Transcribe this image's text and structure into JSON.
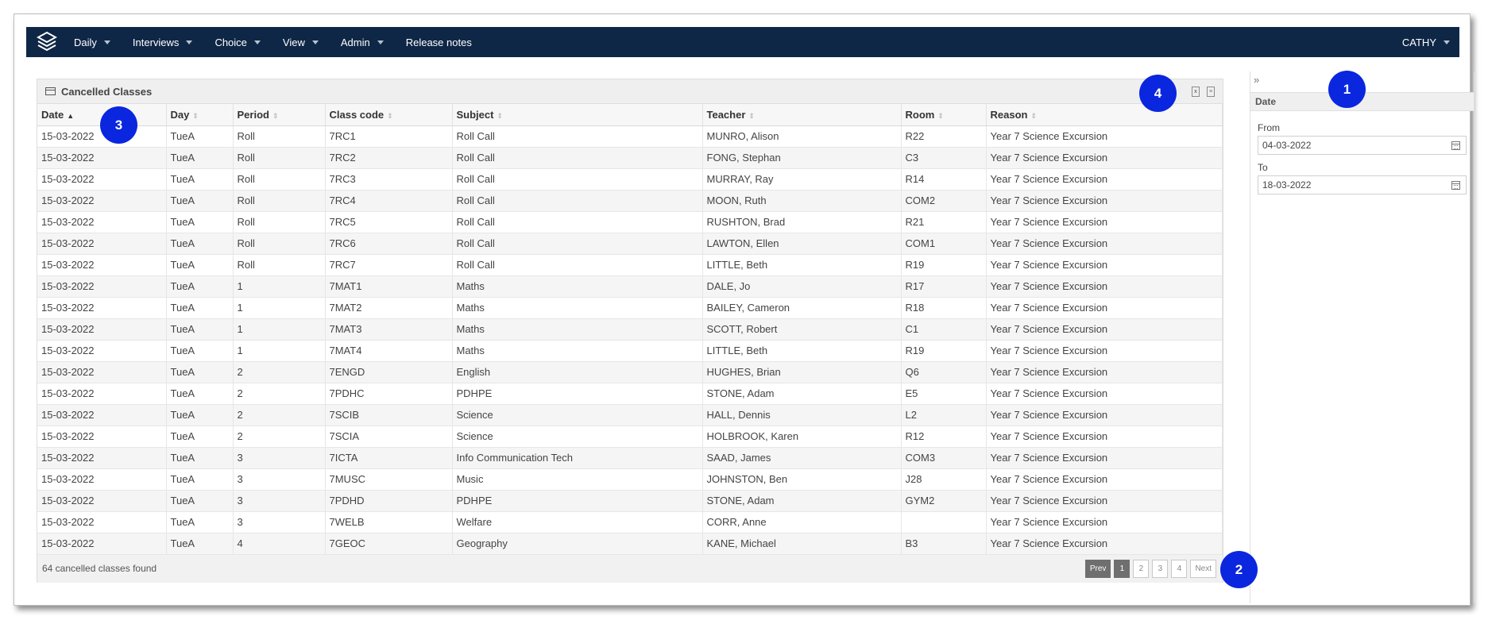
{
  "navbar": {
    "logo_icon": "layers-logo-icon",
    "items": [
      {
        "label": "Daily",
        "dropdown": true
      },
      {
        "label": "Interviews",
        "dropdown": true
      },
      {
        "label": "Choice",
        "dropdown": true
      },
      {
        "label": "View",
        "dropdown": true
      },
      {
        "label": "Admin",
        "dropdown": true
      },
      {
        "label": "Release notes",
        "dropdown": false
      }
    ],
    "user": "CATHY",
    "bg_color": "#0f2746"
  },
  "panel": {
    "title": "Cancelled Classes",
    "export_icons": [
      "excel-export-icon",
      "pdf-export-icon"
    ],
    "columns": [
      "Date",
      "Day",
      "Period",
      "Class code",
      "Subject",
      "Teacher",
      "Room",
      "Reason"
    ],
    "sorted_column": "Date",
    "rows": [
      [
        "15-03-2022",
        "TueA",
        "Roll",
        "7RC1",
        "Roll Call",
        "MUNRO, Alison",
        "R22",
        "Year 7 Science Excursion"
      ],
      [
        "15-03-2022",
        "TueA",
        "Roll",
        "7RC2",
        "Roll Call",
        "FONG, Stephan",
        "C3",
        "Year 7 Science Excursion"
      ],
      [
        "15-03-2022",
        "TueA",
        "Roll",
        "7RC3",
        "Roll Call",
        "MURRAY, Ray",
        "R14",
        "Year 7 Science Excursion"
      ],
      [
        "15-03-2022",
        "TueA",
        "Roll",
        "7RC4",
        "Roll Call",
        "MOON, Ruth",
        "COM2",
        "Year 7 Science Excursion"
      ],
      [
        "15-03-2022",
        "TueA",
        "Roll",
        "7RC5",
        "Roll Call",
        "RUSHTON, Brad",
        "R21",
        "Year 7 Science Excursion"
      ],
      [
        "15-03-2022",
        "TueA",
        "Roll",
        "7RC6",
        "Roll Call",
        "LAWTON, Ellen",
        "COM1",
        "Year 7 Science Excursion"
      ],
      [
        "15-03-2022",
        "TueA",
        "Roll",
        "7RC7",
        "Roll Call",
        "LITTLE, Beth",
        "R19",
        "Year 7 Science Excursion"
      ],
      [
        "15-03-2022",
        "TueA",
        "1",
        "7MAT1",
        "Maths",
        "DALE, Jo",
        "R17",
        "Year 7 Science Excursion"
      ],
      [
        "15-03-2022",
        "TueA",
        "1",
        "7MAT2",
        "Maths",
        "BAILEY, Cameron",
        "R18",
        "Year 7 Science Excursion"
      ],
      [
        "15-03-2022",
        "TueA",
        "1",
        "7MAT3",
        "Maths",
        "SCOTT, Robert",
        "C1",
        "Year 7 Science Excursion"
      ],
      [
        "15-03-2022",
        "TueA",
        "1",
        "7MAT4",
        "Maths",
        "LITTLE, Beth",
        "R19",
        "Year 7 Science Excursion"
      ],
      [
        "15-03-2022",
        "TueA",
        "2",
        "7ENGD",
        "English",
        "HUGHES, Brian",
        "Q6",
        "Year 7 Science Excursion"
      ],
      [
        "15-03-2022",
        "TueA",
        "2",
        "7PDHC",
        "PDHPE",
        "STONE, Adam",
        "E5",
        "Year 7 Science Excursion"
      ],
      [
        "15-03-2022",
        "TueA",
        "2",
        "7SCIB",
        "Science",
        "HALL, Dennis",
        "L2",
        "Year 7 Science Excursion"
      ],
      [
        "15-03-2022",
        "TueA",
        "2",
        "7SCIA",
        "Science",
        "HOLBROOK, Karen",
        "R12",
        "Year 7 Science Excursion"
      ],
      [
        "15-03-2022",
        "TueA",
        "3",
        "7ICTA",
        "Info Communication Tech",
        "SAAD, James",
        "COM3",
        "Year 7 Science Excursion"
      ],
      [
        "15-03-2022",
        "TueA",
        "3",
        "7MUSC",
        "Music",
        "JOHNSTON, Ben",
        "J28",
        "Year 7 Science Excursion"
      ],
      [
        "15-03-2022",
        "TueA",
        "3",
        "7PDHD",
        "PDHPE",
        "STONE, Adam",
        "GYM2",
        "Year 7 Science Excursion"
      ],
      [
        "15-03-2022",
        "TueA",
        "3",
        "7WELB",
        "Welfare",
        "CORR, Anne",
        "",
        "Year 7 Science Excursion"
      ],
      [
        "15-03-2022",
        "TueA",
        "4",
        "7GEOC",
        "Geography",
        "KANE, Michael",
        "B3",
        "Year 7 Science Excursion"
      ]
    ],
    "footer_text": "64 cancelled classes found",
    "pagination": {
      "prev": "Prev",
      "pages": [
        "1",
        "2",
        "3",
        "4"
      ],
      "current": "1",
      "next": "Next"
    }
  },
  "sidebar": {
    "collapse_glyph": "»",
    "heading": "Date",
    "from_label": "From",
    "from_value": "04-03-2022",
    "to_label": "To",
    "to_value": "18-03-2022"
  },
  "callouts": [
    "1",
    "2",
    "3",
    "4"
  ],
  "callout_color": "#0a26de"
}
